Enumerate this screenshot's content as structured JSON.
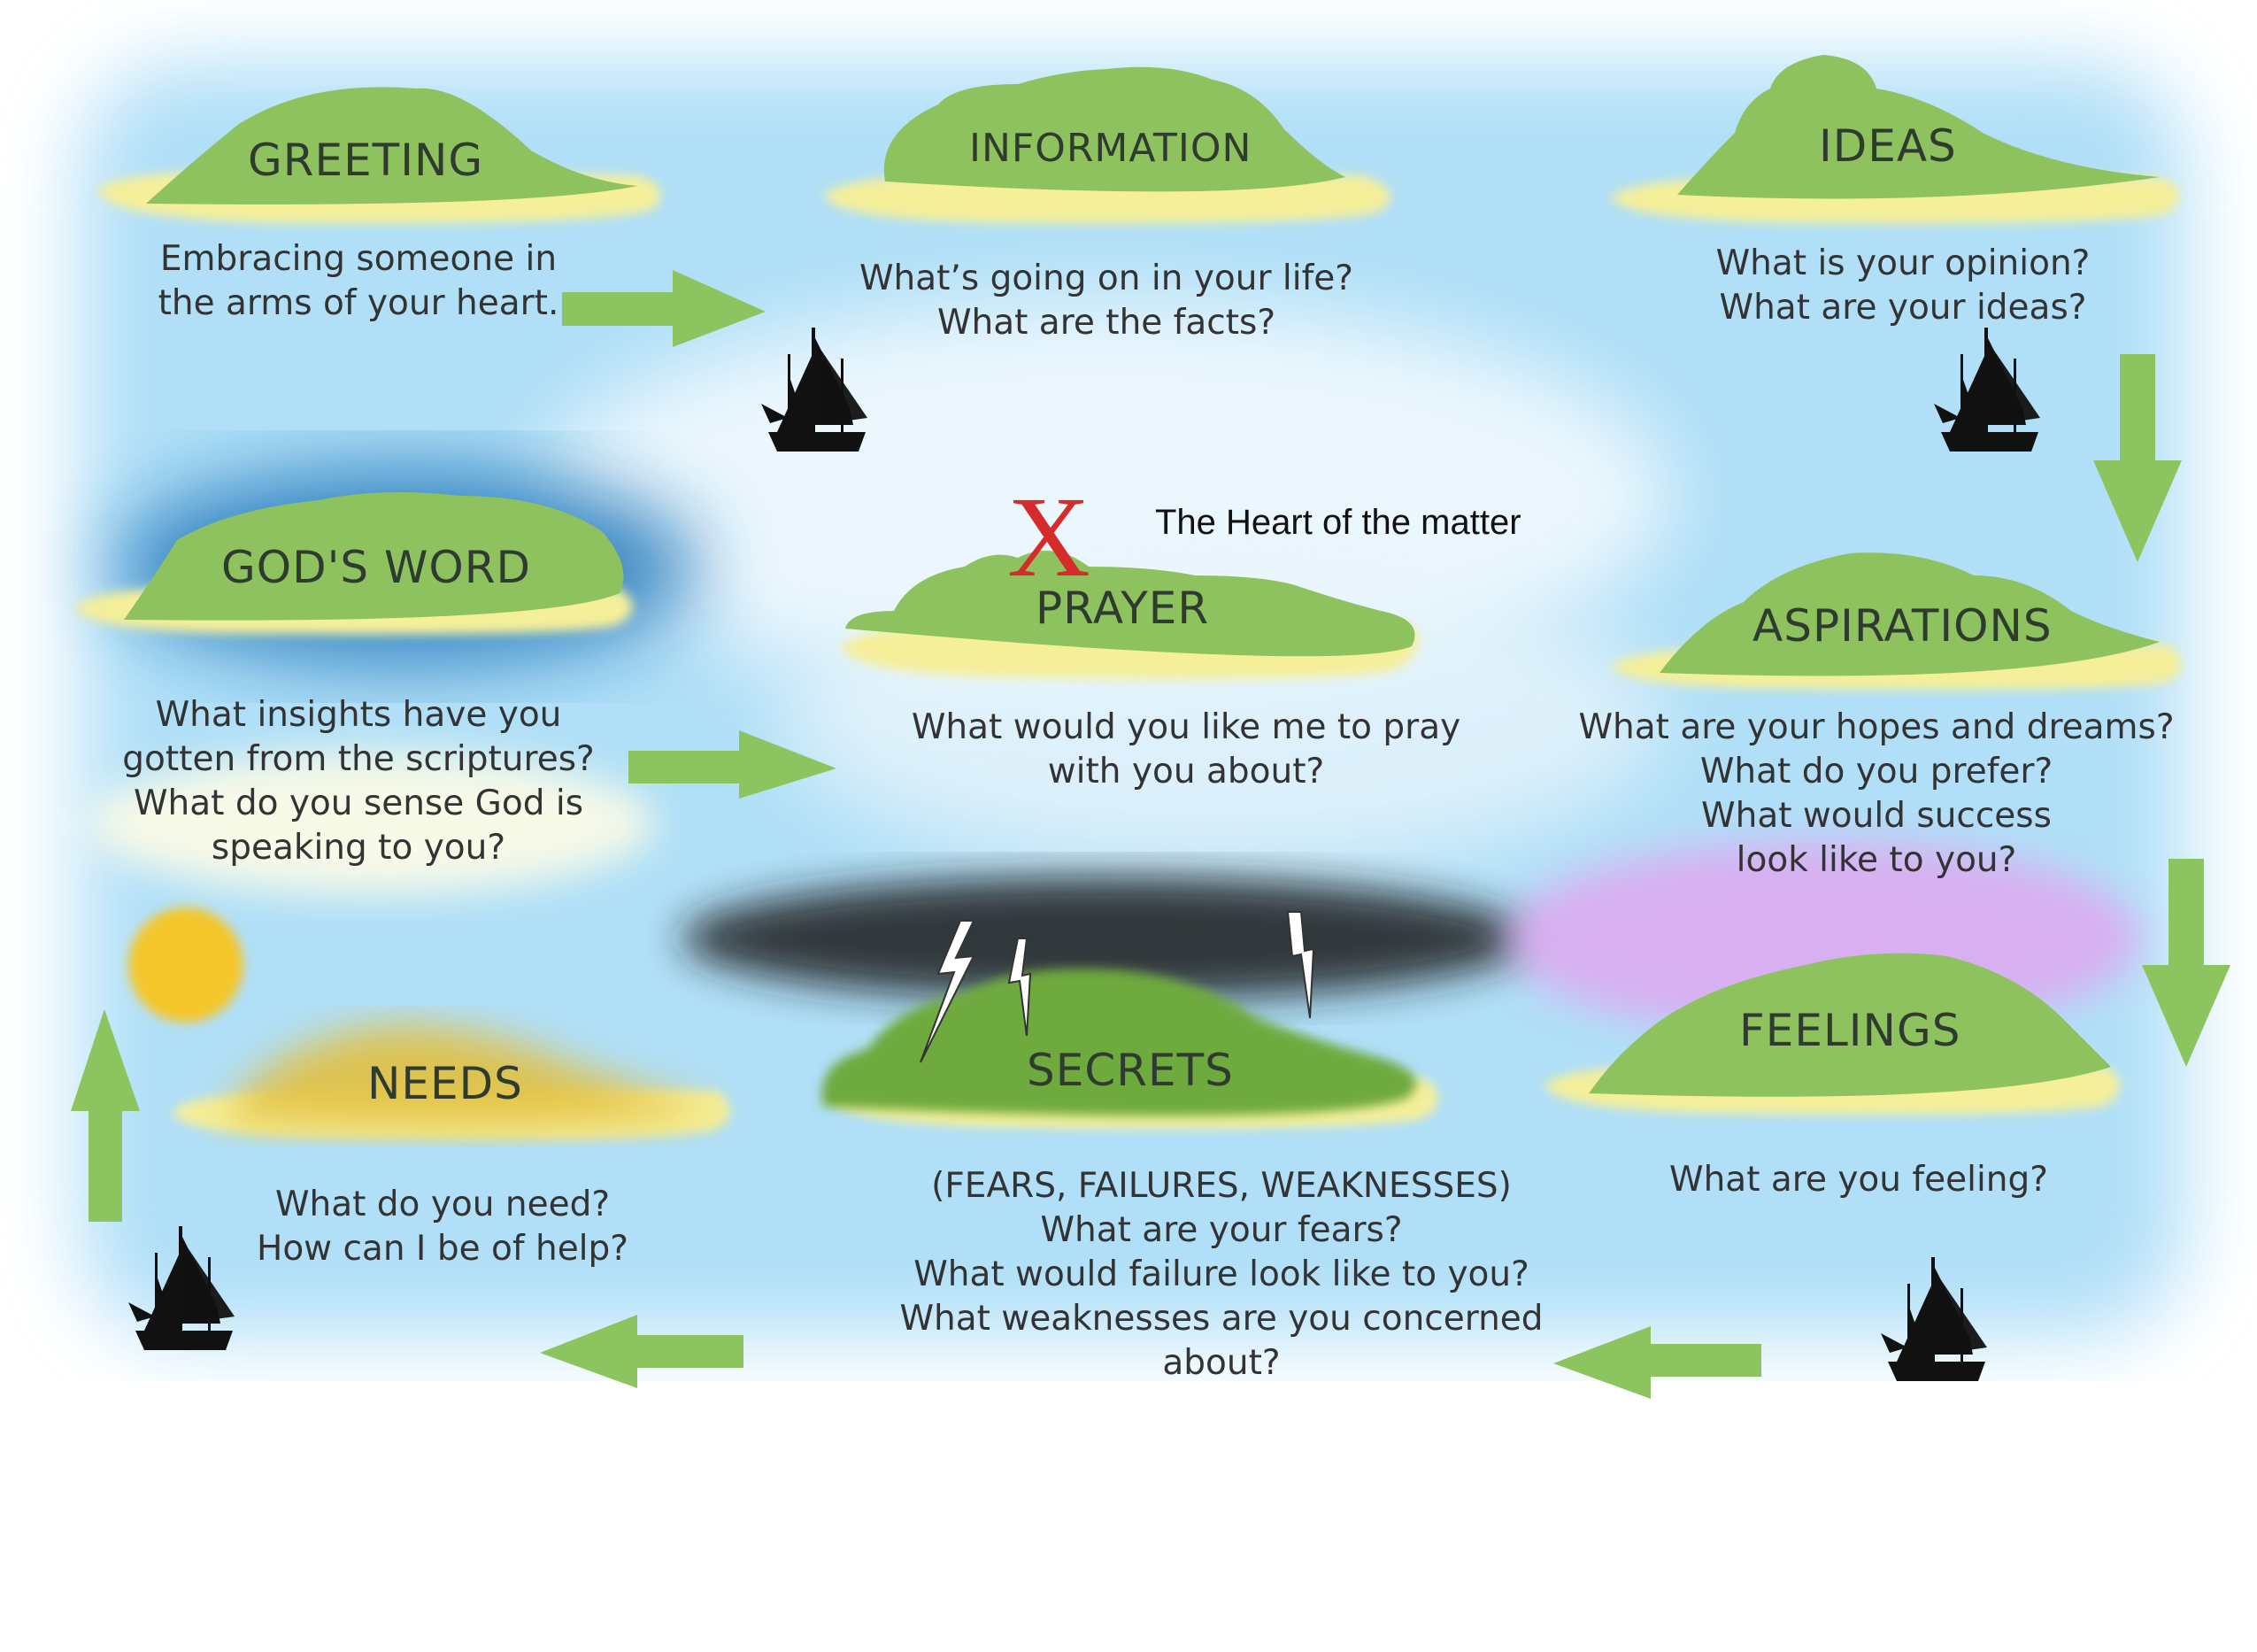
{
  "heart": {
    "mark": "X",
    "label": "The Heart of the matter"
  },
  "islands": {
    "greeting": {
      "title": "GREETING",
      "lines": [
        "Embracing someone in",
        "the arms of your heart."
      ]
    },
    "information": {
      "title": "INFORMATION",
      "lines": [
        "What’s going on in your life?",
        "What are the facts?"
      ]
    },
    "ideas": {
      "title": "IDEAS",
      "lines": [
        "What is your opinion?",
        "What are your ideas?"
      ]
    },
    "gods_word": {
      "title": "GOD'S WORD",
      "lines": [
        "What insights have you",
        "gotten from the scriptures?",
        "What do you sense God is",
        "speaking to you?"
      ]
    },
    "prayer": {
      "title": "PRAYER",
      "lines": [
        "What would you like me to pray",
        "with you about?"
      ]
    },
    "aspirations": {
      "title": "ASPIRATIONS",
      "lines": [
        "What are your hopes and dreams?",
        "What do you prefer?",
        "What would success",
        "look like to you?"
      ]
    },
    "needs": {
      "title": "NEEDS",
      "lines": [
        "What do you need?",
        "How can I be of help?"
      ]
    },
    "secrets": {
      "title": "SECRETS",
      "lines": [
        "(FEARS, FAILURES, WEAKNESSES)",
        "What are your fears?",
        "What would failure look like to you?",
        "What weaknesses are you concerned",
        "about?"
      ]
    },
    "feelings": {
      "title": "FEELINGS",
      "lines": [
        "What are you feeling?"
      ]
    }
  },
  "colors": {
    "sea": "#a8dcf7",
    "island": "#8dc25f",
    "sand": "#f5ef9a",
    "arrow": "#8cc45f",
    "ship": "#111111",
    "x_mark": "#d62b2b"
  },
  "icons": [
    "ship-icon",
    "arrow-right-icon",
    "arrow-down-icon",
    "arrow-left-icon",
    "arrow-up-icon",
    "lightning-icon",
    "sun-icon",
    "x-mark-icon"
  ]
}
